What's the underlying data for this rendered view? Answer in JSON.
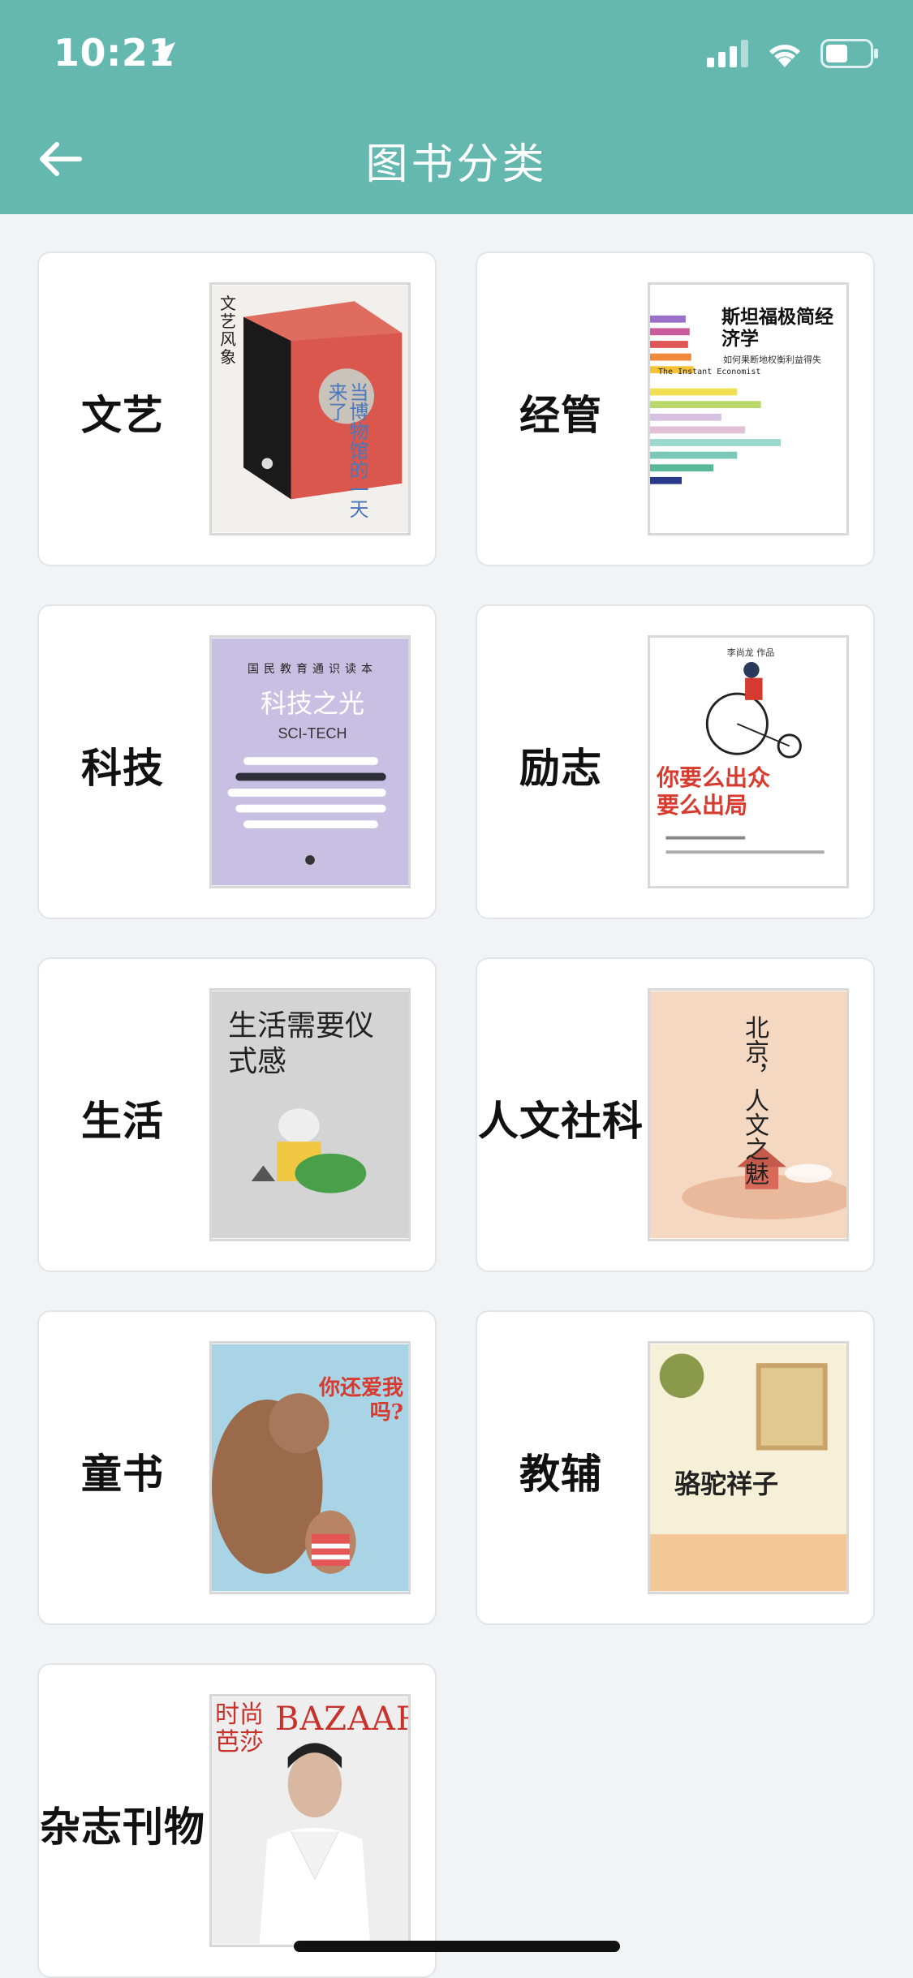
{
  "status_bar": {
    "time": "10:21"
  },
  "header": {
    "title": "图书分类"
  },
  "categories": [
    {
      "label": "文艺",
      "cover_title": "文艺风象",
      "cover_subtitle": "当博物馆的一天来了"
    },
    {
      "label": "经管",
      "cover_title": "斯坦福极简经济学",
      "cover_subtitle": "如何果断地权衡利益得失",
      "cover_en": "The Instant Economist"
    },
    {
      "label": "科技",
      "cover_title": "科技之光",
      "cover_en": "SCI-TECH",
      "cover_top": "国民教育通识读本"
    },
    {
      "label": "励志",
      "cover_title": "你要么出众要么出局",
      "cover_author": "李尚龙 作品"
    },
    {
      "label": "生活",
      "cover_title": "生活需要仪式感"
    },
    {
      "label": "人文社科",
      "cover_title": "北京，人文之魅"
    },
    {
      "label": "童书",
      "cover_title": "你还爱我吗?"
    },
    {
      "label": "教辅",
      "cover_title": "骆驼祥子"
    },
    {
      "label": "杂志刊物",
      "cover_title": "时尚芭莎",
      "cover_en": "BAZAAR"
    }
  ],
  "colors": {
    "header": "#64b8b0",
    "background": "#f2f3f7"
  }
}
